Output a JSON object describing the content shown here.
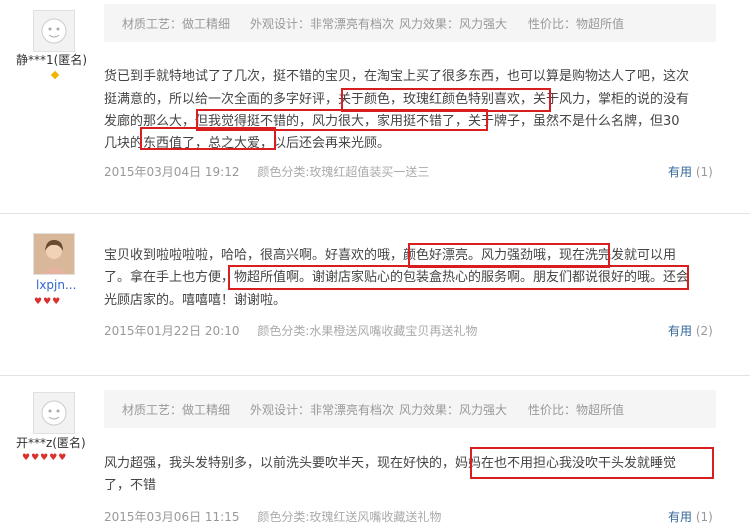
{
  "reviews": [
    {
      "user": "静***1(匿名)",
      "tags": [
        "材质工艺：做工精细",
        "外观设计：非常漂亮有档次",
        "风力效果：风力强大",
        "性价比：物超所值"
      ],
      "lines": [
        "货已到手就特地试了了几次，挺不错的宝贝，在淘宝上买了很多东西，也可以算是购物达人了吧，这次",
        "挺满意的，所以给一次全面的多字好评，关于颜色，玫瑰红颜色特别喜欢，关于风力，掌柜的说的没有",
        "发廊的那么大，但我觉得挺不错的，风力很大，家用挺不错了，关于牌子，虽然不是什么名牌，但30",
        "几块的东西值了，总之大爱，以后还会再来光顾。"
      ],
      "date": "2015年03月04日 19:12",
      "variant": "颜色分类:玫瑰红超值装买一送三",
      "useful": "有用",
      "useful_count": "(1)"
    },
    {
      "user": "lxpjn...",
      "lines": [
        "宝贝收到啦啦啦啦，哈哈，很高兴啊。好喜欢的哦，颜色好漂亮。风力强劲哦，现在洗完发就可以用",
        "了。拿在手上也方便，物超所值啊。谢谢店家贴心的包装盒热心的服务啊。朋友们都说很好的哦。还会",
        "光顾店家的。嘻嘻嘻！谢谢啦。"
      ],
      "date": "2015年01月22日 20:10",
      "variant": "颜色分类:水果橙送风嘴收藏宝贝再送礼物",
      "useful": "有用",
      "useful_count": "(2)"
    },
    {
      "user": "开***z(匿名)",
      "tags": [
        "材质工艺：做工精细",
        "外观设计：非常漂亮有档次",
        "风力效果：风力强大",
        "性价比：物超所值"
      ],
      "lines": [
        "风力超强，我头发特别多，以前洗头要吹半天，现在好快的，妈妈在也不用担心我没吹干头发就睡觉",
        "了，不错"
      ],
      "date": "2015年03月06日 11:15",
      "variant": "颜色分类:玫瑰红送风嘴收藏送礼物",
      "useful": "有用",
      "useful_count": "(1)"
    }
  ],
  "hearts": {
    "review2": "♥♥♥",
    "review3": "♥♥♥♥♥"
  },
  "colors": {
    "highlight": "#d81e1e",
    "link": "#336699",
    "tagbar": "#f5f5f5"
  }
}
